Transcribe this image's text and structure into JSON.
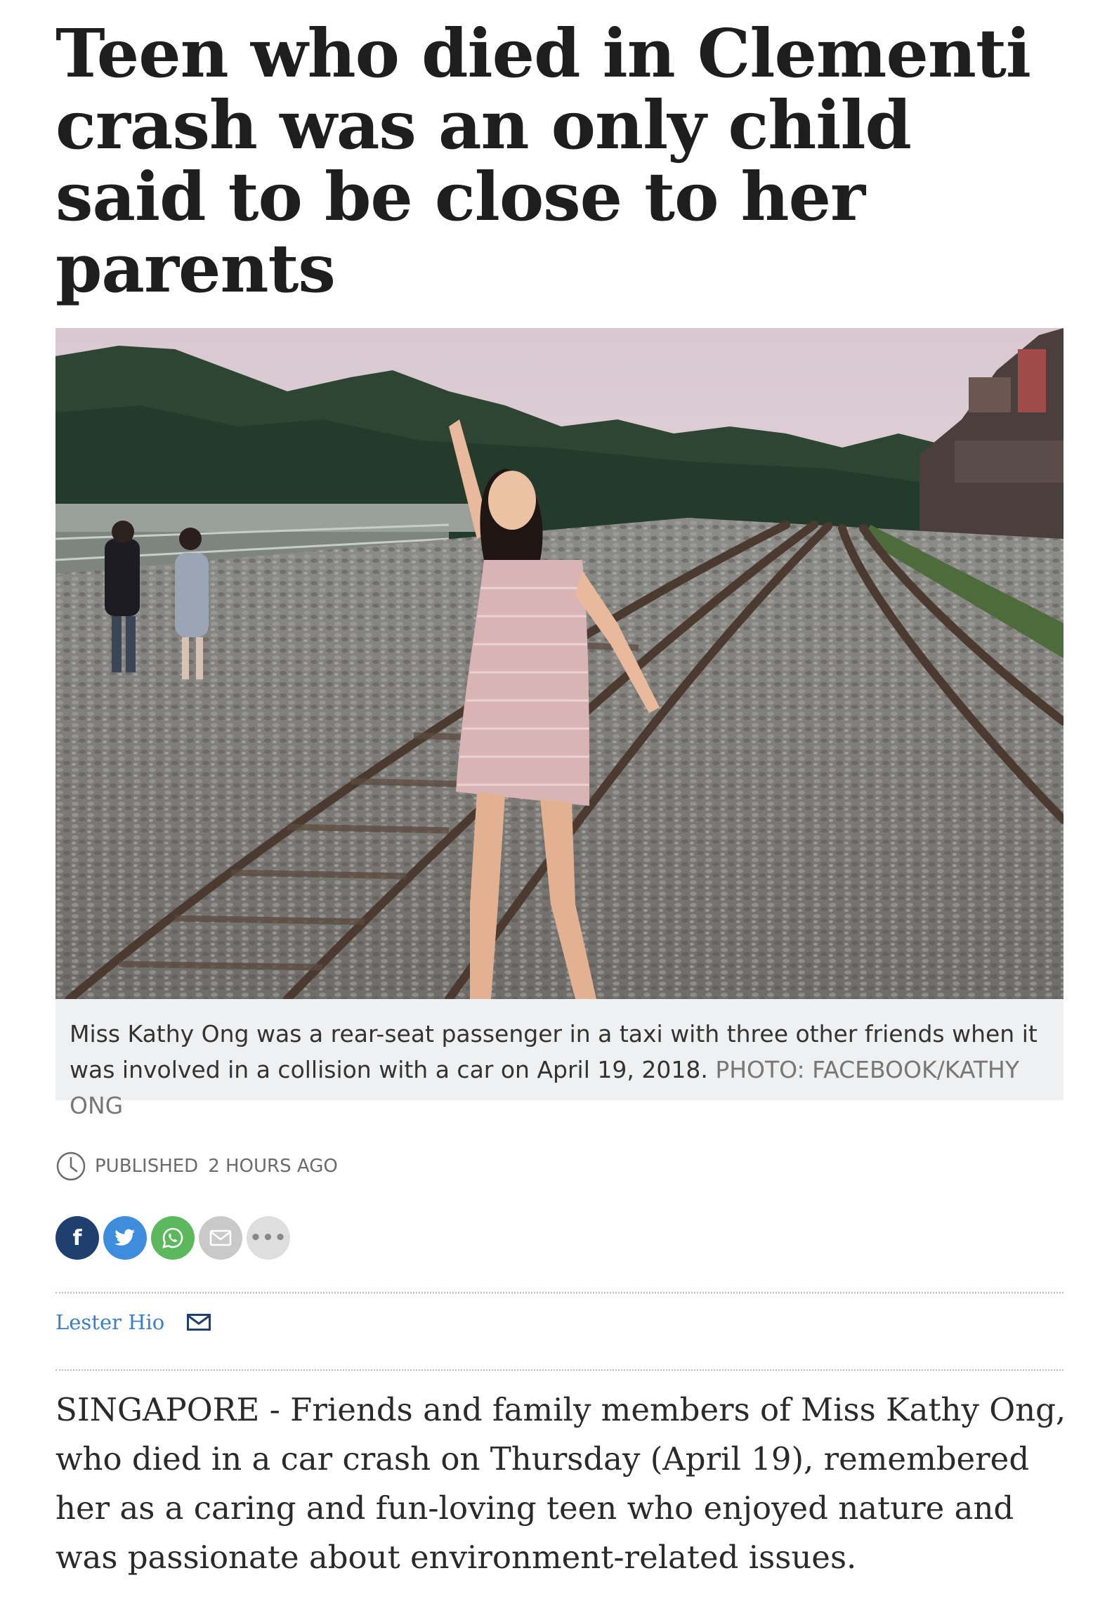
{
  "article": {
    "headline": "Teen who died in Clementi crash was an only child said to be close to her parents",
    "photo": {
      "caption": "Miss Kathy Ong was a rear-seat passenger in a taxi with three other friends when it was involved in a collision with a car on April 19, 2018.",
      "credit": "PHOTO: FACEBOOK/KATHY ONG"
    },
    "published": {
      "label": "PUBLISHED",
      "time": "2 HOURS AGO",
      "icon": "clock-icon"
    },
    "share": {
      "facebook_glyph": "f",
      "more_glyph": "•••",
      "icons": [
        "facebook-icon",
        "twitter-icon",
        "whatsapp-icon",
        "email-icon",
        "more-icon"
      ],
      "colors": {
        "facebook": "#1f3f6e",
        "twitter": "#3e8ddc",
        "whatsapp": "#5cb85c",
        "email": "#c9c9c9",
        "more": "#dedede"
      }
    },
    "author": {
      "name": "Lester Hio",
      "icon": "envelope-icon"
    },
    "body": "SINGAPORE - Friends and family members of Miss Kathy Ong, who died in a car crash on Thursday (April 19), remembered her as a caring and fun-loving teen who enjoyed nature and was passionate about environment-related issues."
  }
}
